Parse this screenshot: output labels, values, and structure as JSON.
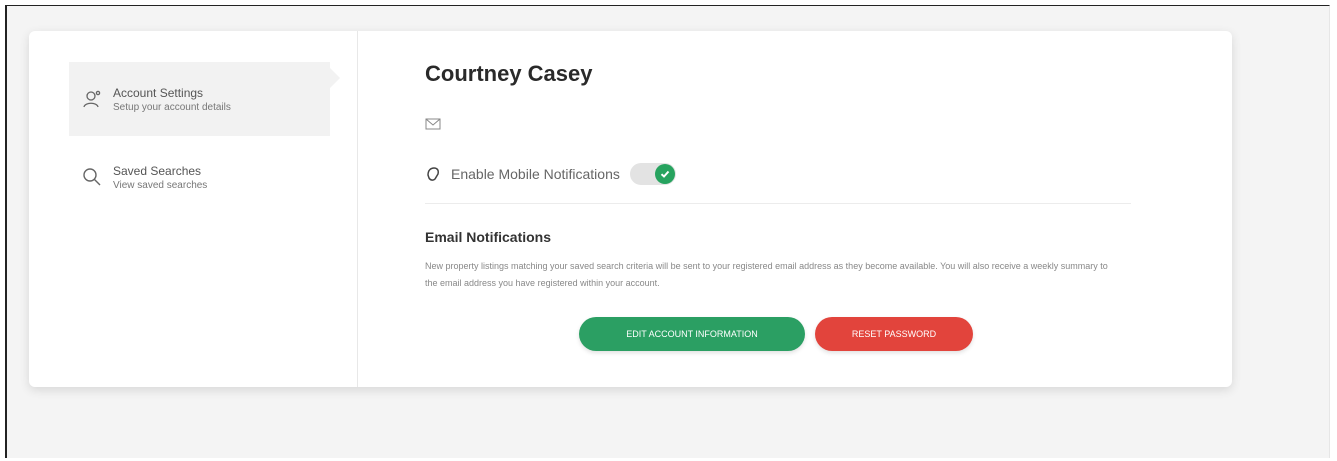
{
  "sidebar": {
    "items": [
      {
        "title": "Account Settings",
        "subtitle": "Setup your account details",
        "icon": "user-icon"
      },
      {
        "title": "Saved Searches",
        "subtitle": "View saved searches",
        "icon": "search-icon"
      }
    ]
  },
  "profile": {
    "name": "Courtney Casey",
    "email": ""
  },
  "notifications": {
    "mobile_label": "Enable Mobile Notifications",
    "mobile_enabled": true
  },
  "email_section": {
    "title": "Email Notifications",
    "description": "New property listings matching your saved search criteria will be sent to your registered email address as they become available. You will also receive a weekly summary to the email address you have registered within your account."
  },
  "actions": {
    "edit_label": "Edit Account Information",
    "reset_label": "Reset Password"
  },
  "colors": {
    "edit_button": "#2b9f63",
    "reset_button": "#e2443c",
    "toggle_on": "#27a35f"
  }
}
